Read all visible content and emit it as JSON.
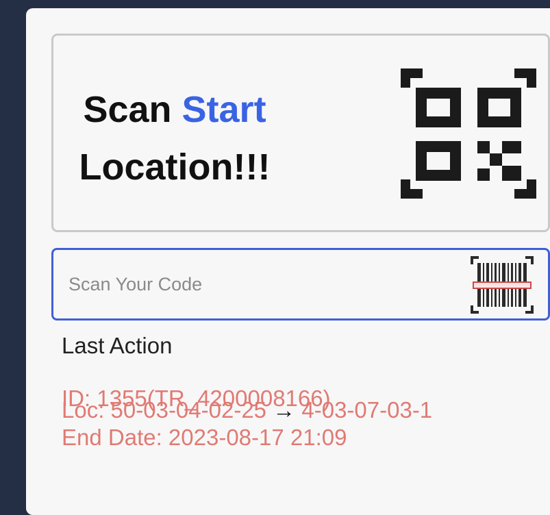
{
  "scan_card": {
    "title_prefix": "Scan ",
    "title_accent": "Start",
    "title_suffix": "Location!!!",
    "accent_color": "#3a63e4",
    "icon": "qr-code-icon"
  },
  "code_field": {
    "placeholder": "Scan Your Code",
    "value": "",
    "border_color": "#3f5fd8",
    "icon": "barcode-scanner-icon"
  },
  "last_action": {
    "label": "Last Action",
    "id_line": "ID: 1355(TR_4200008166)",
    "loc_from": "Loc: 50-03-04-02-25",
    "arrow": "→",
    "loc_to": "4-03-07-03-1",
    "date_line": "End Date: 2023-08-17 21:09",
    "text_color": "#e07a74"
  }
}
